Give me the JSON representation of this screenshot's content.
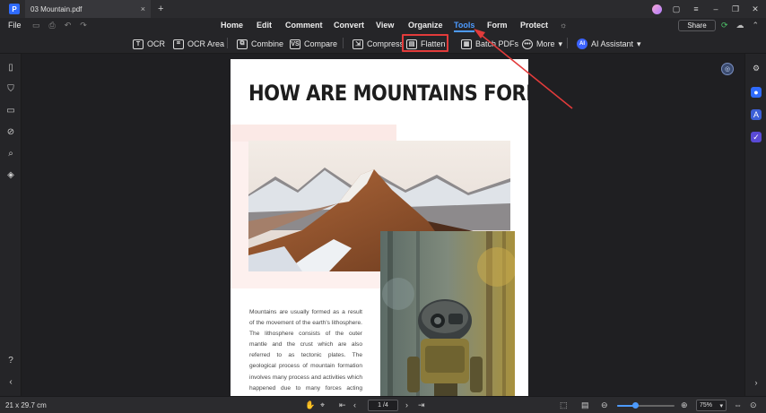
{
  "window": {
    "tab_title": "03 Mountain.pdf",
    "new_tab": "+",
    "close_tab": "×"
  },
  "menu": {
    "file": "File",
    "items": [
      "Home",
      "Edit",
      "Comment",
      "Convert",
      "View",
      "Organize",
      "Tools",
      "Form",
      "Protect"
    ],
    "active": "Tools",
    "share": "Share"
  },
  "toolbar": {
    "ocr": "OCR",
    "ocr_area": "OCR Area",
    "combine": "Combine",
    "compare": "Compare",
    "compress": "Compress",
    "flatten": "Flatten",
    "batch_pdfs": "Batch PDFs",
    "more": "More",
    "ai_assistant": "AI Assistant",
    "highlighted_tool": "Flatten"
  },
  "document": {
    "title": "HOW ARE MOUNTAINS FORMED?",
    "body": "Mountains are usually formed as a result of the movement of the earth's lithosphere. The lithosphere consists of the outer mantle and the crust which are also referred to as tectonic plates. The geological process of mountain formation involves many process and activities which happened due to many forces acting together or in isolation. The"
  },
  "status": {
    "page_size": "21 x 29.7 cm",
    "page_indicator": "1 /4",
    "zoom": "75%",
    "zoom_level": 0.32
  },
  "colors": {
    "accent": "#4d9bff",
    "annotation": "#e23b3b",
    "page_bg": "#ffffff",
    "app_bg": "#1f1f22"
  }
}
